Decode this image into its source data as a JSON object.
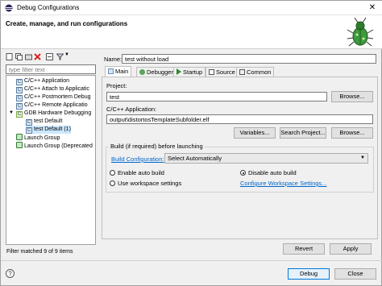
{
  "window": {
    "title": "Debug Configurations"
  },
  "header": {
    "title": "Create, manage, and run configurations"
  },
  "left": {
    "filter_placeholder": "type filter text",
    "tree": [
      {
        "label": "C/C++ Application",
        "indent": 1
      },
      {
        "label": "C/C++ Attach to Applicatic",
        "indent": 1
      },
      {
        "label": "C/C++ Postmortem Debug",
        "indent": 1
      },
      {
        "label": "C/C++ Remote Applicatio",
        "indent": 1
      },
      {
        "label": "GDB Hardware Debugging",
        "indent": 1
      },
      {
        "label": "test Default",
        "indent": 2
      },
      {
        "label": "test Default (1)",
        "indent": 2
      },
      {
        "label": "Launch Group",
        "indent": 1
      },
      {
        "label": "Launch Group (Deprecated",
        "indent": 1
      }
    ],
    "status": "Filter matched 9 of 9 items"
  },
  "config": {
    "name_label": "Name:",
    "name_value": "test without load",
    "tabs": [
      "Main",
      "Debugger",
      "Startup",
      "Source",
      "Common"
    ],
    "project_label": "Project:",
    "project_value": "test",
    "browse1": "Browse...",
    "app_label": "C/C++ Application:",
    "app_value": "output\\distortosTemplateSubfolder.elf",
    "variables": "Variables...",
    "search_project": "Search Project...",
    "browse2": "Browse...",
    "build_group": "Build (if required) before launching",
    "build_conf_label": "Build Configuration:",
    "build_conf_value": "Select Automatically",
    "enable_auto": "Enable auto build",
    "disable_auto": "Disable auto build",
    "use_workspace": "Use workspace settings",
    "configure_ws": "Configure Workspace Settings...",
    "revert": "Revert",
    "apply": "Apply"
  },
  "footer": {
    "debug": "Debug",
    "close": "Close"
  }
}
